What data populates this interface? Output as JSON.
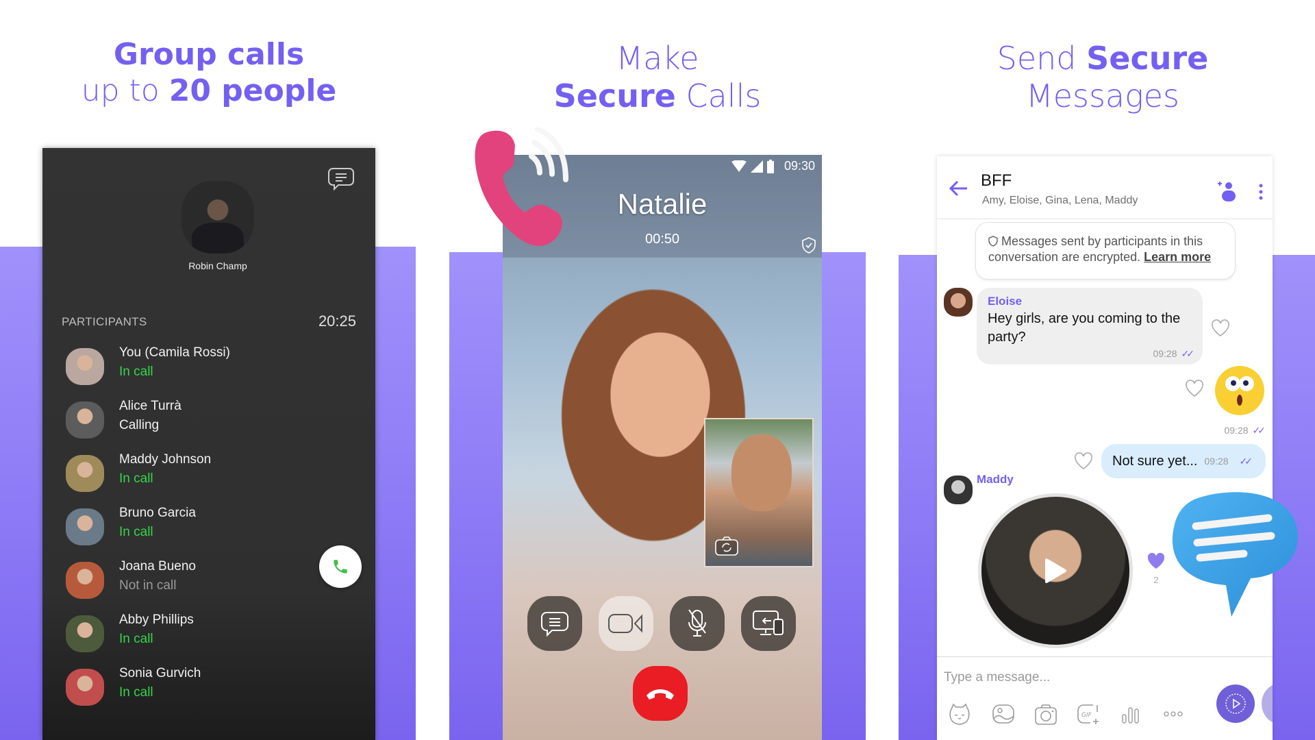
{
  "headlines": [
    {
      "line1_bold": "Group calls",
      "line2_light": "up to ",
      "line2_bold": "20 people"
    },
    {
      "line1_light": "Make",
      "line2_bold": "Secure",
      "line2_light": " Calls"
    },
    {
      "line1_light": "Send ",
      "line1_bold": "Secure",
      "line2_light": "Messages"
    }
  ],
  "colors": {
    "brand": "#7360f2",
    "in_call": "#35d54a",
    "end_call": "#ea1c24"
  },
  "group_call": {
    "host_name": "Robin Champ",
    "participants_label": "PARTICIPANTS",
    "timer": "20:25",
    "chat_icon": "chat-bubble-icon",
    "participants": [
      {
        "name": "You (Camila Rossi)",
        "status": "In call",
        "state": "in"
      },
      {
        "name": "Alice Turrà",
        "status": "Calling",
        "state": "calling"
      },
      {
        "name": "Maddy Johnson",
        "status": "In call",
        "state": "in"
      },
      {
        "name": "Bruno Garcia",
        "status": "In call",
        "state": "in"
      },
      {
        "name": "Joana Bueno",
        "status": "Not in call",
        "state": "not"
      },
      {
        "name": "Abby Phillips",
        "status": "In call",
        "state": "in"
      },
      {
        "name": "Sonia Gurvich",
        "status": "In call",
        "state": "in"
      }
    ],
    "callback_icon": "phone-icon"
  },
  "video_call": {
    "status_time": "09:30",
    "caller_name": "Natalie",
    "duration": "00:50",
    "controls": [
      "chat-icon",
      "video-icon",
      "mute-mic-icon",
      "transfer-screen-icon"
    ],
    "end_icon": "hang-up-icon"
  },
  "chat": {
    "title": "BFF",
    "members": "Amy, Eloise, Gina, Lena, Maddy",
    "notice": "Messages sent by participants in this conversation are encrypted.",
    "notice_link": "Learn more",
    "messages": [
      {
        "sender": "Eloise",
        "text": "Hey girls, are you coming to the party?",
        "time": "09:28"
      },
      {
        "type": "sticker",
        "time": "09:28"
      },
      {
        "text": "Not sure yet...",
        "time": "09:28"
      },
      {
        "sender": "Maddy",
        "type": "video",
        "likes": "2"
      }
    ],
    "input_placeholder": "Type a message...",
    "composer_icons": [
      "sticker-icon",
      "gallery-icon",
      "camera-icon",
      "gif-icon",
      "voice-bars-icon",
      "more-icon"
    ]
  }
}
